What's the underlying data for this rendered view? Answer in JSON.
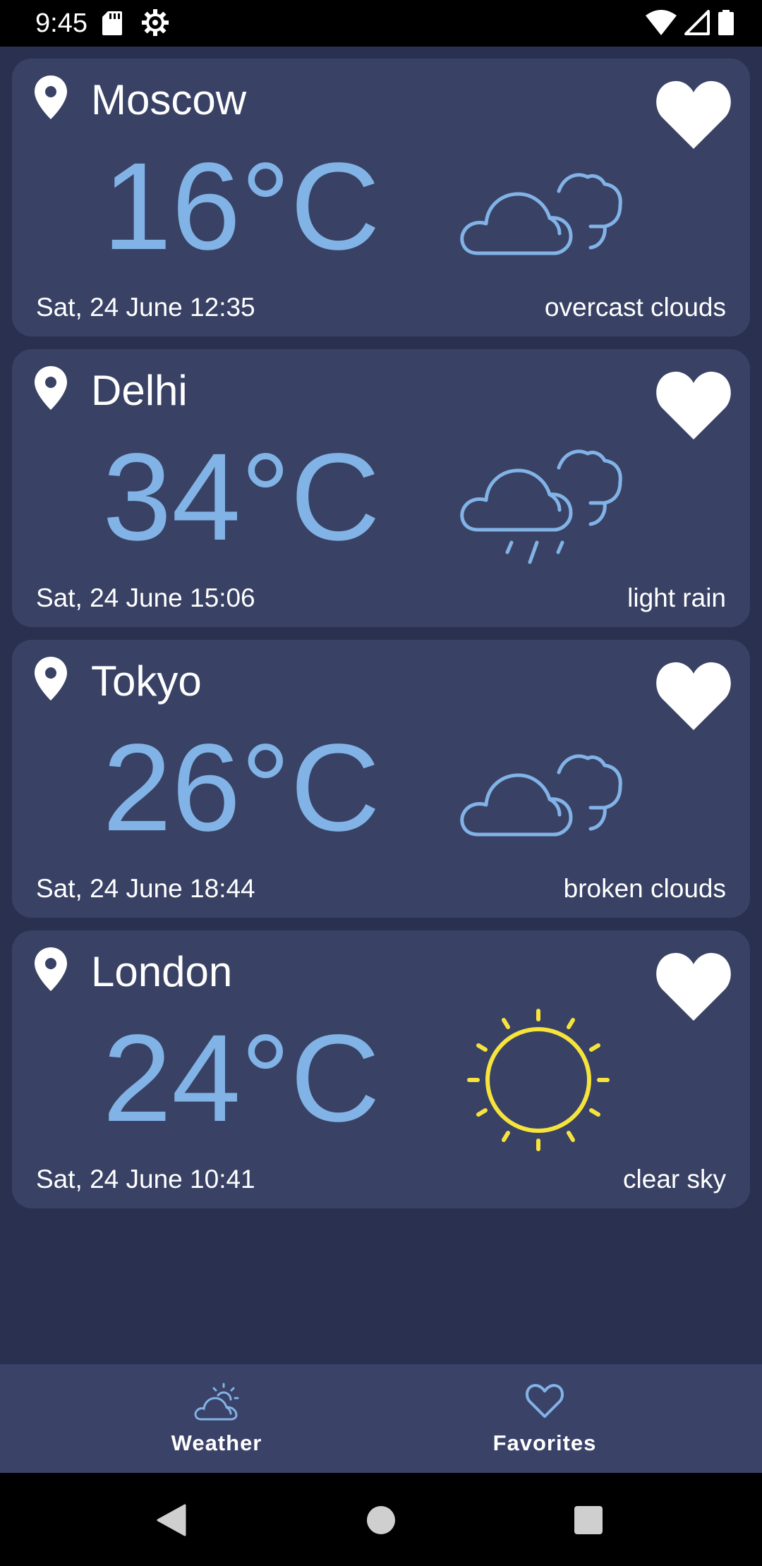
{
  "status_bar": {
    "time": "9:45"
  },
  "cards": [
    {
      "city": "Moscow",
      "temp": "16°C",
      "date": "Sat, 24 June 12:35",
      "description": "overcast clouds",
      "icon": "cloud-icon"
    },
    {
      "city": "Delhi",
      "temp": "34°C",
      "date": "Sat, 24 June 15:06",
      "description": "light rain",
      "icon": "rain-cloud-icon"
    },
    {
      "city": "Tokyo",
      "temp": "26°C",
      "date": "Sat, 24 June 18:44",
      "description": "broken clouds",
      "icon": "cloud-icon"
    },
    {
      "city": "London",
      "temp": "24°C",
      "date": "Sat, 24 June 10:41",
      "description": "clear sky",
      "icon": "sun-icon"
    }
  ],
  "bottom_nav": {
    "weather_label": "Weather",
    "favorites_label": "Favorites"
  },
  "colors": {
    "background": "#2a3150",
    "card": "#394265",
    "temperature": "#82b3e6",
    "sun": "#f6e43c"
  }
}
